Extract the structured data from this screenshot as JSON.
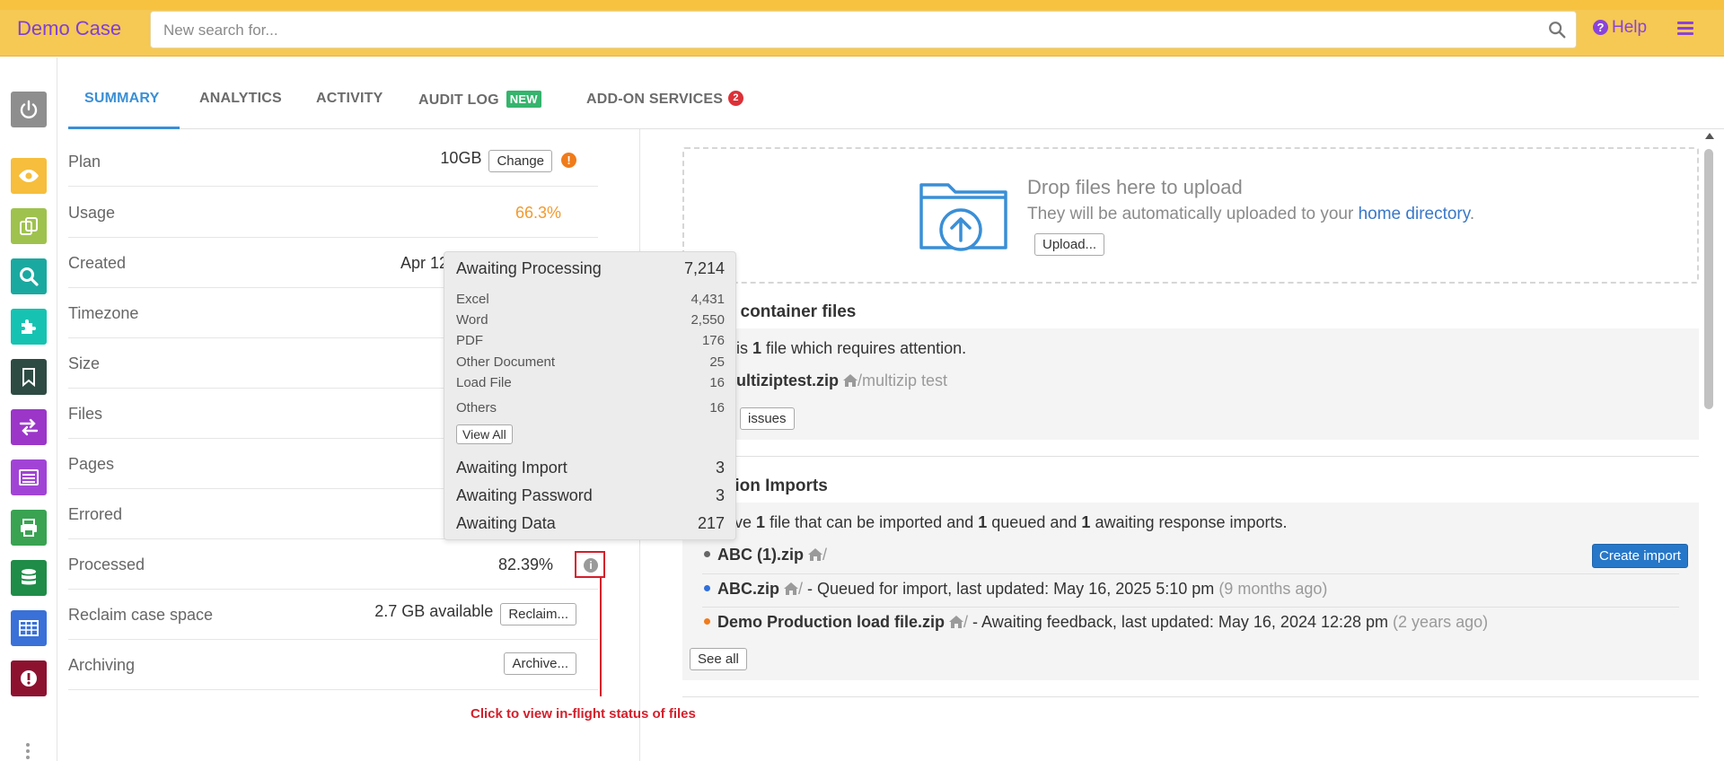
{
  "header": {
    "brand": "Demo Case",
    "search_placeholder": "New search for...",
    "help_label": "Help"
  },
  "sidebar": {
    "items": [
      {
        "name": "power",
        "color": "#8e8e8e"
      },
      {
        "name": "eye",
        "color": "#f6be3c"
      },
      {
        "name": "copy",
        "color": "#9fc24e"
      },
      {
        "name": "search",
        "color": "#1aa9a0"
      },
      {
        "name": "puzzle",
        "color": "#16c3b2"
      },
      {
        "name": "bookmark",
        "color": "#2e4b43"
      },
      {
        "name": "transfer",
        "color": "#9b36c9"
      },
      {
        "name": "list",
        "color": "#a144d6"
      },
      {
        "name": "print",
        "color": "#39a352"
      },
      {
        "name": "database",
        "color": "#1f8c48"
      },
      {
        "name": "table",
        "color": "#3a71d8"
      },
      {
        "name": "alert",
        "color": "#8c1230"
      }
    ]
  },
  "tabs": {
    "summary": "SUMMARY",
    "analytics": "ANALYTICS",
    "activity": "ACTIVITY",
    "audit_log": "AUDIT LOG",
    "audit_badge": "NEW",
    "addon": "ADD-ON SERVICES",
    "addon_badge": "2"
  },
  "summary": {
    "plan_label": "Plan",
    "plan_value": "10GB",
    "change_btn": "Change",
    "usage_label": "Usage",
    "usage_value": "66.3%",
    "created_label": "Created",
    "created_value": "Apr 12",
    "timezone_label": "Timezone",
    "size_label": "Size",
    "files_label": "Files",
    "pages_label": "Pages",
    "errored_label": "Errored",
    "processed_label": "Processed",
    "processed_value": "82.39%",
    "reclaim_label": "Reclaim case space",
    "reclaim_value": "2.7 GB available",
    "reclaim_btn": "Reclaim...",
    "archiving_label": "Archiving",
    "archive_btn": "Archive..."
  },
  "popover": {
    "awaiting_processing": "Awaiting Processing",
    "awaiting_processing_count": "7,214",
    "types": [
      {
        "label": "Excel",
        "count": "4,431"
      },
      {
        "label": "Word",
        "count": "2,550"
      },
      {
        "label": "PDF",
        "count": "176"
      },
      {
        "label": "Other Document",
        "count": "25"
      },
      {
        "label": "Load File",
        "count": "16"
      },
      {
        "label": "Others",
        "count": "16"
      }
    ],
    "view_all": "View All",
    "awaiting_import": "Awaiting Import",
    "awaiting_import_count": "3",
    "awaiting_password": "Awaiting Password",
    "awaiting_password_count": "3",
    "awaiting_data": "Awaiting Data",
    "awaiting_data_count": "217"
  },
  "callout": "Click to view in-flight status of files",
  "dropzone": {
    "title": "Drop files here to upload",
    "subtitle": "They will be automatically uploaded to your",
    "link": "home directory",
    "period": ".",
    "upload_btn": "Upload..."
  },
  "container": {
    "title": "l container files",
    "line_prefix": "is",
    "count": "1",
    "line_suffix": "file which requires attention.",
    "file": "ultiziptest.zip",
    "path": "/multizip test",
    "issues_btn": "issues"
  },
  "imports": {
    "title": "tion Imports",
    "line_a": "ave",
    "count_a": "1",
    "line_b": "file that can be imported and",
    "count_b": "1",
    "line_c": "queued and",
    "count_c": "1",
    "line_d": "awaiting response imports.",
    "items": [
      {
        "name": "ABC (1).zip",
        "path": "/",
        "status": "",
        "ago": "",
        "dot": "#666666"
      },
      {
        "name": "ABC.zip",
        "path": "/",
        "status": " -  Queued for import, last updated: May 16, 2025 5:10 pm",
        "ago": "(9 months ago)",
        "dot": "#2f6fdc"
      },
      {
        "name": "Demo Production load file.zip",
        "path": "/",
        "status": " -  Awaiting feedback, last updated: May 16, 2024 12:28 pm",
        "ago": "(2 years ago)",
        "dot": "#f07b1a"
      }
    ],
    "create_btn": "Create import",
    "see_all": "See all"
  }
}
